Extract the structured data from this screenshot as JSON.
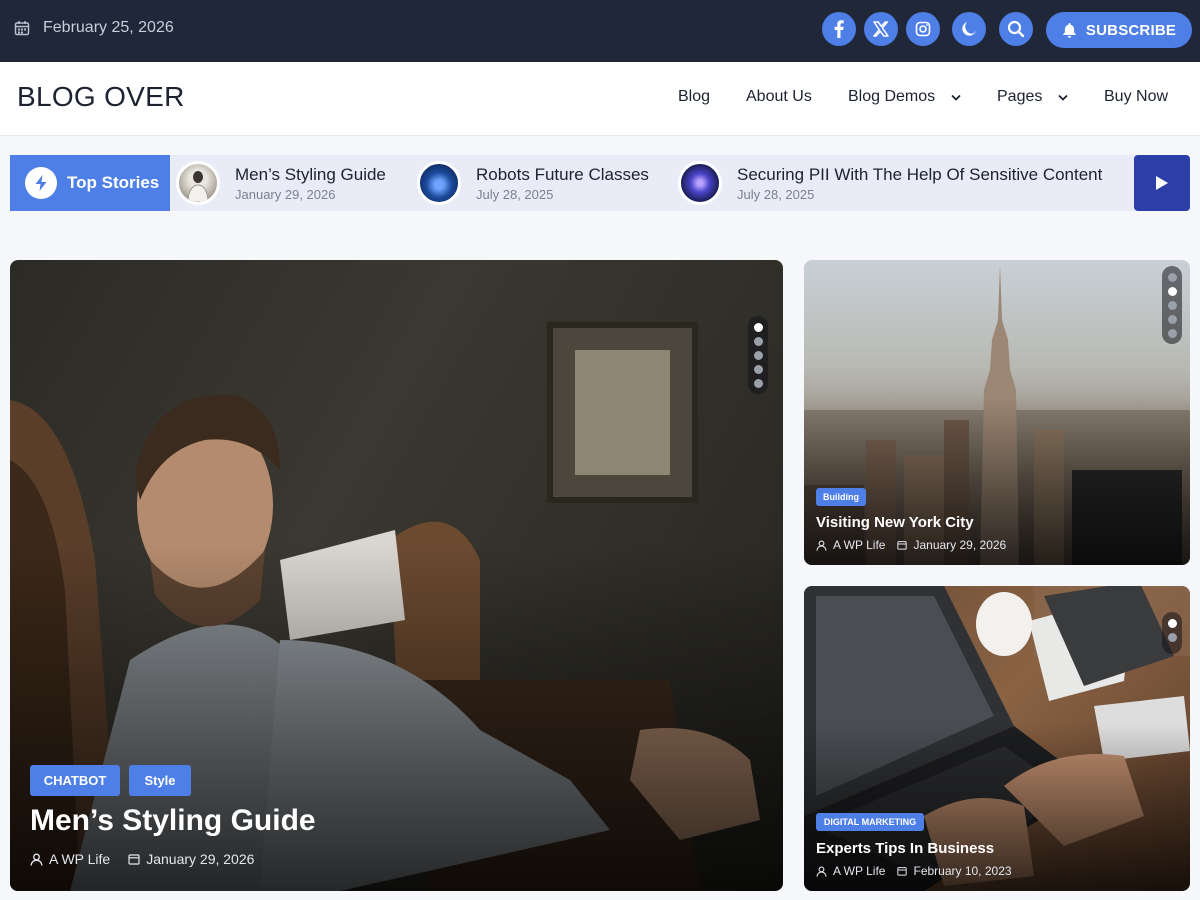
{
  "topbar": {
    "date": "February 25, 2026",
    "social_icons": [
      "facebook-icon",
      "x-twitter-icon",
      "instagram-icon",
      "moon-icon",
      "search-icon"
    ],
    "subscribe_label": "SUBSCRIBE"
  },
  "header": {
    "logo": "BLOG OVER",
    "nav": [
      {
        "label": "Blog",
        "dropdown": false
      },
      {
        "label": "About Us",
        "dropdown": false
      },
      {
        "label": "Blog Demos",
        "dropdown": true
      },
      {
        "label": "Pages",
        "dropdown": true
      },
      {
        "label": "Buy Now",
        "dropdown": false
      }
    ]
  },
  "ticker": {
    "label": "Top Stories",
    "stories": [
      {
        "title": "Men’s Styling Guide",
        "date": "January 29, 2026"
      },
      {
        "title": "Robots Future Classes",
        "date": "July 28, 2025"
      },
      {
        "title": "Securing PII With The Help Of Sensitive Content",
        "date": "July 28, 2025"
      }
    ]
  },
  "featured": {
    "tags": [
      "CHATBOT",
      "Style"
    ],
    "title": "Men’s Styling Guide",
    "author": "A WP Life",
    "date": "January 29, 2026"
  },
  "side_posts": [
    {
      "tag": "Building",
      "title": "Visiting New York City",
      "author": "A WP Life",
      "date": "January 29, 2026"
    },
    {
      "tag": "DIGITAL MARKETING",
      "title": "Experts Tips In Business",
      "author": "A WP Life",
      "date": "February 10, 2023"
    }
  ],
  "colors": {
    "topbar_bg": "#1f2738",
    "accent": "#4e7fe6",
    "ticker_bg": "#e9ecf7",
    "play_button": "#2c3fa8"
  }
}
